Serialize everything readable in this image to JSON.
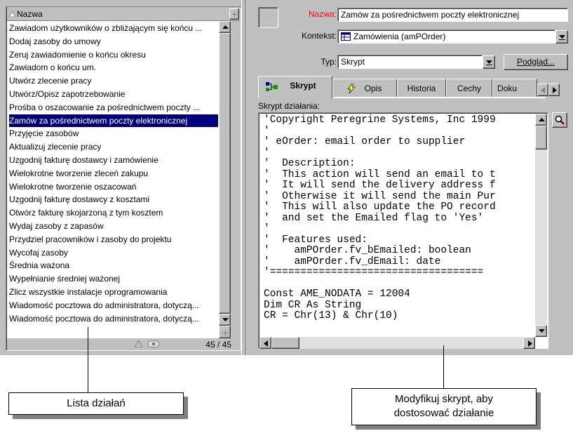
{
  "list": {
    "header": "Nazwa",
    "items": [
      "Zawiadom użytkowników o zbliżającym się końcu ...",
      "Dodaj zasoby do umowy",
      "Zeruj zawiadomienie o końcu okresu",
      "Zawiadom o końcu um.",
      "Utwórz zlecenie pracy",
      "Utwórz/Opisz zapotrzebowanie",
      "Prośba o oszacowanie za pośrednictwem poczty ...",
      "Zamów za pośrednictwem poczty elektronicznej",
      "Przyjęcie zasobów",
      "Aktualizuj zlecenie pracy",
      "Uzgodnij fakturę dostawcy i zamówienie",
      "Wielokrotne tworzenie zleceń zakupu",
      "Wielokrotne tworzenie oszacowań",
      "Uzgodnij fakturę dostawcy z kosztami",
      "Otwórz fakturę skojarzoną z tym kosztem",
      "Wydaj zasoby z zapasów",
      "Przydziel pracowników i zasoby do projektu",
      "Wycofaj zasoby",
      "Średnia ważona",
      "Wypełnianie średniej ważonej",
      "Zlicz wszystkie instalacje oprogramowania",
      "Wiadomość pocztowa do administratora, dotyczą...",
      "Wiadomość pocztowa do administratora, dotyczą..."
    ],
    "selected_index": 7,
    "counter": "45 / 45"
  },
  "form": {
    "name_label": "Nazwa:",
    "name_value": "Zamów za pośrednictwem poczty elektronicznej",
    "context_label": "Kontekst:",
    "context_value": "Zamówienia (amPOrder)",
    "type_label": "Typ:",
    "type_value": "Skrypt",
    "preview_button": "Podgląd..."
  },
  "tabs": [
    "Skrypt",
    "Opis",
    "Historia",
    "Cechy",
    "Doku"
  ],
  "script": {
    "label": "Skrypt działania:",
    "lines": [
      "'Copyright Peregrine Systems, Inc 1999",
      "'",
      "' eOrder: email order to supplier",
      "'",
      "'  Description:",
      "'  This action will send an email to t",
      "'  It will send the delivery address f",
      "'  Otherwise it will send the main Pur",
      "'  This will also update the PO record",
      "'  and set the Emailed flag to 'Yes'",
      "'",
      "'  Features used:",
      "'    amPOrder.fv_bEmailed: boolean",
      "'    amPOrder.fv_dEmail: date",
      "'===================================",
      "",
      "Const AME_NODATA = 12004",
      "Dim CR As String",
      "CR = Chr(13) & Chr(10)"
    ]
  },
  "callouts": {
    "left": "Lista działań",
    "right_line1": "Modyfikuj skrypt, aby",
    "right_line2": "dostosować działanie"
  },
  "colors": {
    "window": "#c0c0c0",
    "selection": "#000080",
    "name_label": "#ff0000"
  }
}
